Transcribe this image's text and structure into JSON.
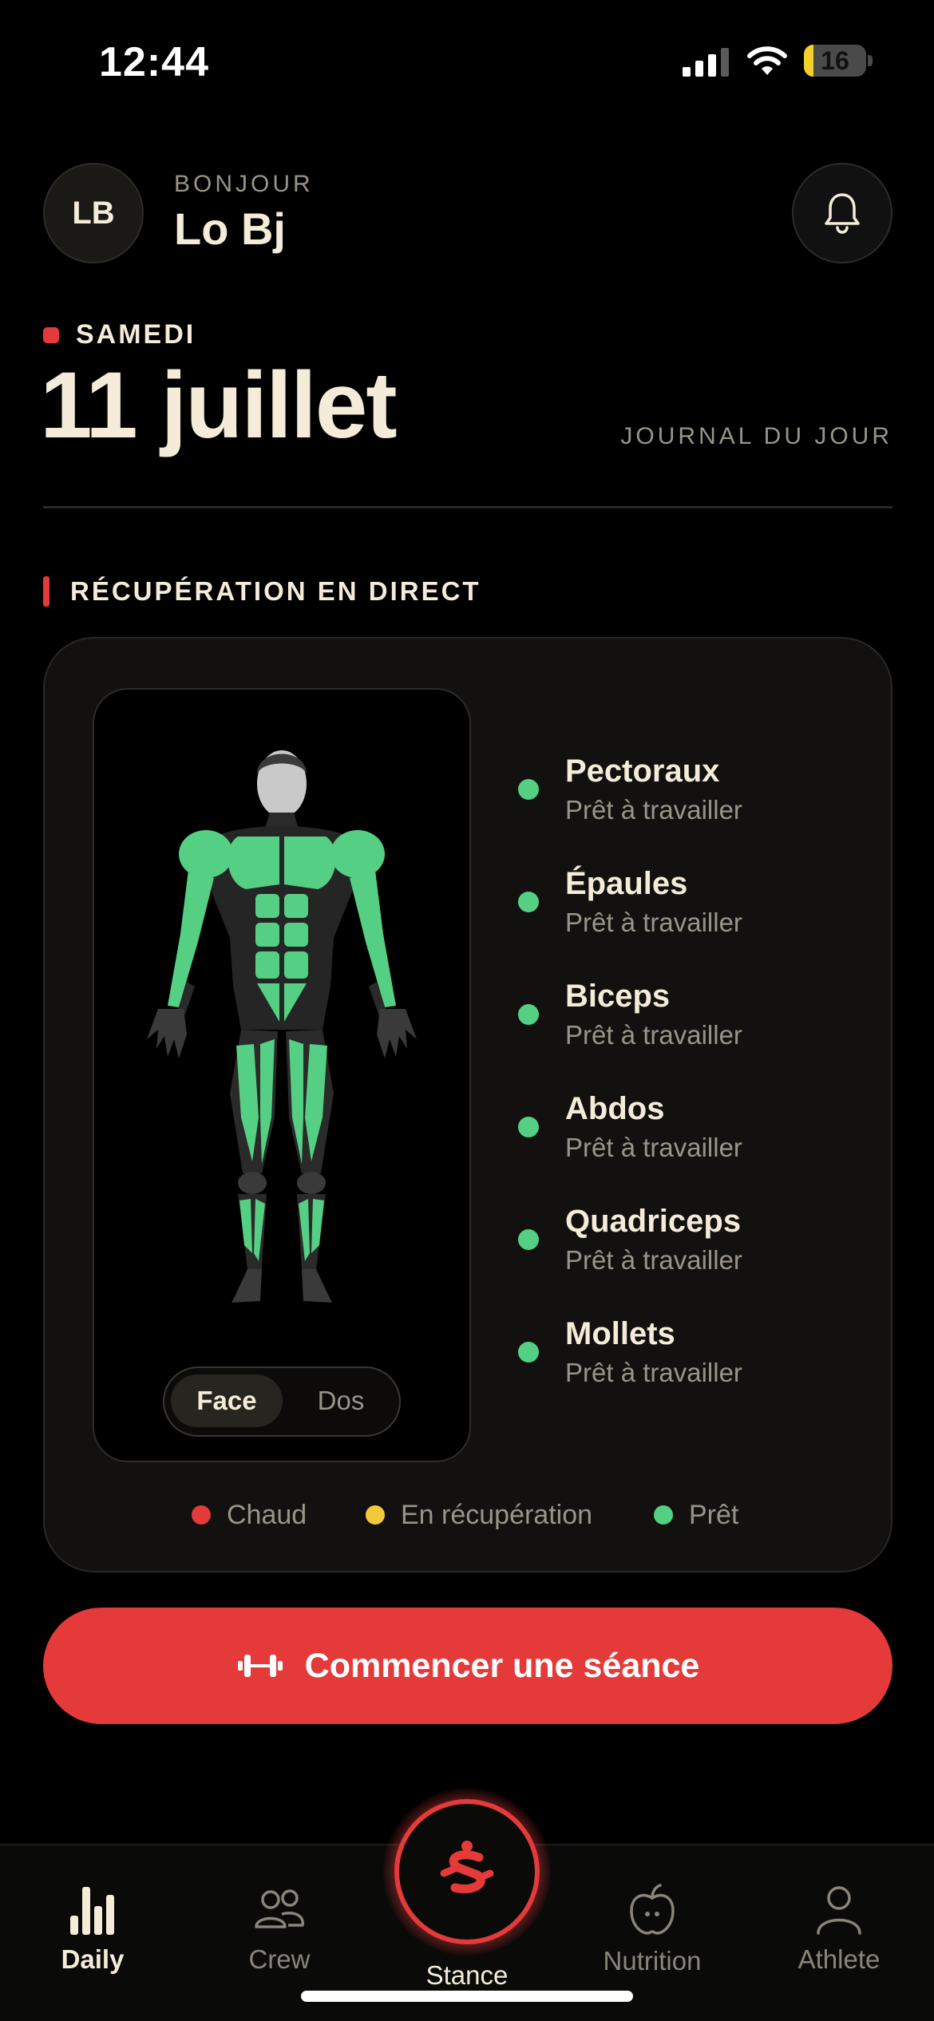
{
  "status_bar": {
    "time": "12:44",
    "battery": "16",
    "battery_level": 0.16
  },
  "header": {
    "avatar_initials": "LB",
    "greeting": "BONJOUR",
    "user_name": "Lo Bj"
  },
  "date": {
    "weekday": "SAMEDI",
    "full": "11 juillet",
    "journal_label": "JOURNAL DU JOUR"
  },
  "recovery": {
    "title": "RÉCUPÉRATION EN DIRECT",
    "view_toggle": {
      "front": "Face",
      "back": "Dos",
      "selected": "Face"
    },
    "muscles": [
      {
        "name": "Pectoraux",
        "status": "Prêt à travailler"
      },
      {
        "name": "Épaules",
        "status": "Prêt à travailler"
      },
      {
        "name": "Biceps",
        "status": "Prêt à travailler"
      },
      {
        "name": "Abdos",
        "status": "Prêt à travailler"
      },
      {
        "name": "Quadriceps",
        "status": "Prêt à travailler"
      },
      {
        "name": "Mollets",
        "status": "Prêt à travailler"
      }
    ],
    "legend": [
      {
        "label": "Chaud",
        "color": "#e43a3a"
      },
      {
        "label": "En récupération",
        "color": "#f2c93a"
      },
      {
        "label": "Prêt",
        "color": "#55cf83"
      }
    ]
  },
  "cta": {
    "label": "Commencer une séance"
  },
  "tabs": [
    {
      "label": "Daily",
      "icon": "bar-chart-icon",
      "active": true
    },
    {
      "label": "Crew",
      "icon": "people-icon",
      "active": false
    },
    {
      "label": "Stance",
      "icon": "stance-logo-icon",
      "active": false
    },
    {
      "label": "Nutrition",
      "icon": "apple-icon",
      "active": false
    },
    {
      "label": "Athlete",
      "icon": "person-icon",
      "active": false
    }
  ],
  "colors": {
    "accent": "#e43a3a",
    "ready": "#55cf83",
    "background": "#000000",
    "text": "#f4ecd8"
  }
}
